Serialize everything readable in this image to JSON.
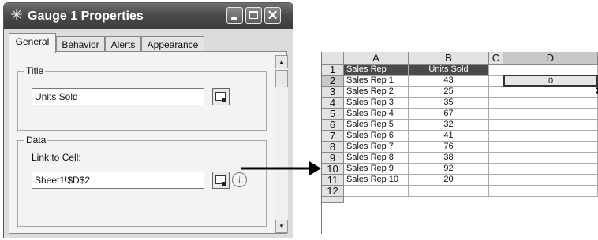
{
  "window": {
    "title": "Gauge 1 Properties"
  },
  "tabs": [
    {
      "label": "General",
      "active": true
    },
    {
      "label": "Behavior",
      "active": false
    },
    {
      "label": "Alerts",
      "active": false
    },
    {
      "label": "Appearance",
      "active": false
    }
  ],
  "title_group": {
    "label": "Title",
    "value": "Units Sold"
  },
  "data_group": {
    "label": "Data",
    "link_label": "Link to Cell:",
    "link_value": "Sheet1!$D$2"
  },
  "sheet": {
    "columns": [
      "A",
      "B",
      "C",
      "D"
    ],
    "selected_column": "D",
    "selected_row": "2",
    "header_row": {
      "row": "1",
      "a": "Sales Rep",
      "b": "Units Sold"
    },
    "rows": [
      {
        "row": "2",
        "a": "Sales Rep 1",
        "b": "43",
        "d": "0"
      },
      {
        "row": "3",
        "a": "Sales Rep 2",
        "b": "25"
      },
      {
        "row": "4",
        "a": "Sales Rep 3",
        "b": "35"
      },
      {
        "row": "5",
        "a": "Sales Rep 4",
        "b": "67"
      },
      {
        "row": "6",
        "a": "Sales Rep 5",
        "b": "32"
      },
      {
        "row": "7",
        "a": "Sales Rep 6",
        "b": "41"
      },
      {
        "row": "8",
        "a": "Sales Rep 7",
        "b": "76"
      },
      {
        "row": "9",
        "a": "Sales Rep 8",
        "b": "38"
      },
      {
        "row": "10",
        "a": "Sales Rep 9",
        "b": "92"
      },
      {
        "row": "11",
        "a": "Sales Rep 10",
        "b": "20"
      },
      {
        "row": "12"
      }
    ]
  },
  "icons": {
    "app": "sparkle-icon",
    "cell_picker": "cell-reference-icon",
    "info": "info-icon",
    "resize": "resize-cursor-icon"
  },
  "colors": {
    "titlebar": "#4a4a4a",
    "header_fill": "#4a4a4a",
    "selection": "#c8c8c8"
  }
}
